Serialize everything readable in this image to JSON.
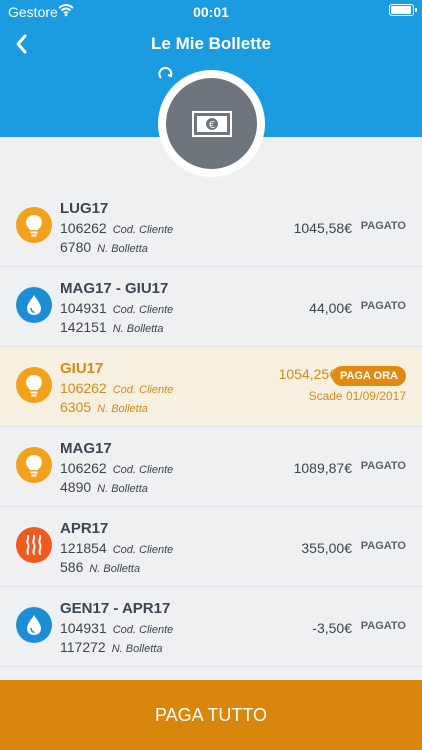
{
  "status_bar": {
    "carrier": "Gestore",
    "time": "00:01"
  },
  "header": {
    "title": "Le Mie Bollette"
  },
  "colors": {
    "header_blue": "#1b9be0",
    "electric": "#f2a11b",
    "water": "#1d8ed6",
    "gas": "#ef5a1f",
    "highlight_text": "#d38b1a",
    "footer": "#d8860c"
  },
  "labels": {
    "code": "Cod. Cliente",
    "bill": "N. Bolletta"
  },
  "bills": [
    {
      "type": "electric",
      "icon": "lightbulb-icon",
      "period": "LUG17",
      "client_code": "106262",
      "bill_number": "6780",
      "amount": "1045,58€",
      "status": "PAGATO"
    },
    {
      "type": "water",
      "icon": "water-drop-icon",
      "period": "MAG17 - GIU17",
      "client_code": "104931",
      "bill_number": "142151",
      "amount": "44,00€",
      "status": "PAGATO"
    },
    {
      "type": "electric",
      "icon": "lightbulb-icon",
      "period": "GIU17",
      "client_code": "106262",
      "bill_number": "6305",
      "amount": "1054,25€",
      "status": "PAGA ORA",
      "due": "Scade 01/09/2017"
    },
    {
      "type": "electric",
      "icon": "lightbulb-icon",
      "period": "MAG17",
      "client_code": "106262",
      "bill_number": "4890",
      "amount": "1089,87€",
      "status": "PAGATO"
    },
    {
      "type": "gas",
      "icon": "heat-icon",
      "period": "APR17",
      "client_code": "121854",
      "bill_number": "586",
      "amount": "355,00€",
      "status": "PAGATO"
    },
    {
      "type": "water",
      "icon": "water-drop-icon",
      "period": "GEN17 - APR17",
      "client_code": "104931",
      "bill_number": "117272",
      "amount": "-3,50€",
      "status": "PAGATO"
    }
  ],
  "footer": {
    "pay_all": "PAGA TUTTO"
  }
}
